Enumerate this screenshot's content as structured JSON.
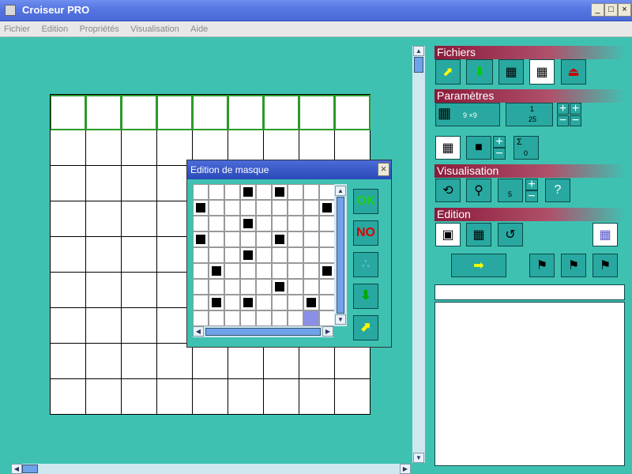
{
  "window": {
    "title": "Croiseur PRO",
    "min": "_",
    "max": "□",
    "close": "×"
  },
  "menu": [
    "Fichier",
    "Edition",
    "Propriétés",
    "Visualisation",
    "Aide"
  ],
  "panel": {
    "sections": {
      "fichiers": "Fichiers",
      "parametres": "Paramètres",
      "visualisation": "Visualisation",
      "edition": "Edition"
    },
    "size_label": "9 ×9",
    "word_length": "1",
    "word_length2": "25",
    "sigma_value": "0",
    "columns_value": "5",
    "help_label": "?"
  },
  "dialog": {
    "title": "Edition de masque",
    "close": "×",
    "ok_label": "OK",
    "no_label": "NO",
    "mask_rows": [
      "...B.B...",
      "B.......B",
      "...B.....",
      "B....B...",
      "...B.....",
      ".B......B",
      ".....B...",
      ".B.B...B.",
      ".......S."
    ]
  }
}
